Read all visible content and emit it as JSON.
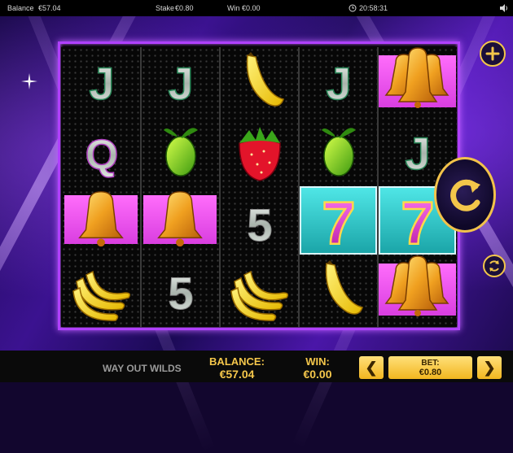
{
  "status_bar": {
    "balance_label": "Balance",
    "balance_value": "€57.04",
    "stake_label": "Stake",
    "stake_value": "€0.80",
    "win_label": "Win",
    "win_value": "€0.00",
    "time": "20:58:31",
    "clock_icon": "clock-icon",
    "sound_icon": "speaker-icon"
  },
  "reels": {
    "rows": [
      [
        "J",
        "J",
        "banana",
        "J",
        "bells"
      ],
      [
        "Q",
        "lime",
        "strawberry",
        "lime",
        "J"
      ],
      [
        "bell",
        "bell",
        "5",
        "seven",
        "seven"
      ],
      [
        "bananas",
        "5",
        "bananas",
        "banana",
        "bells"
      ]
    ]
  },
  "side_controls": {
    "plus_icon": "plus-icon",
    "spin_icon": "spin-arrow-icon",
    "autoplay_icon": "autoplay-icon"
  },
  "bottom_bar": {
    "game_title": "WAY OUT WILDS",
    "balance_label": "BALANCE:",
    "balance_value": "€57.04",
    "win_label": "WIN:",
    "win_value": "€0.00",
    "bet_label": "BET:",
    "bet_value": "€0.80",
    "decrease_symbol": "❮",
    "increase_symbol": "❯"
  },
  "colors": {
    "accent_gold": "#f5c74b",
    "frame_purple": "#b040ff",
    "pink_highlight": "#ff6dfb",
    "teal_highlight": "#4fe6e6"
  }
}
